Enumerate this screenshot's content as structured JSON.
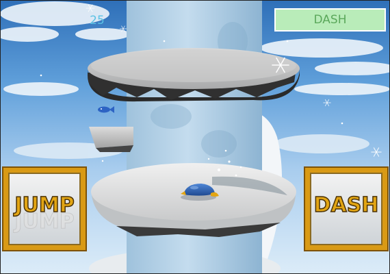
{
  "hud": {
    "score": "25",
    "dash_meter_label": "DASH"
  },
  "controls": {
    "jump_label": "JUMP",
    "dash_label": "DASH"
  },
  "icons": {
    "player": "penguin-icon",
    "pickup": "fish-icon",
    "decoration": "snowflake-icon"
  },
  "colors": {
    "button_frame": "#d99a15",
    "button_text": "#e2a514",
    "dash_meter": "#b9ecb9",
    "score_text": "#5bc2e4",
    "player_body": "#2c5fb0"
  }
}
